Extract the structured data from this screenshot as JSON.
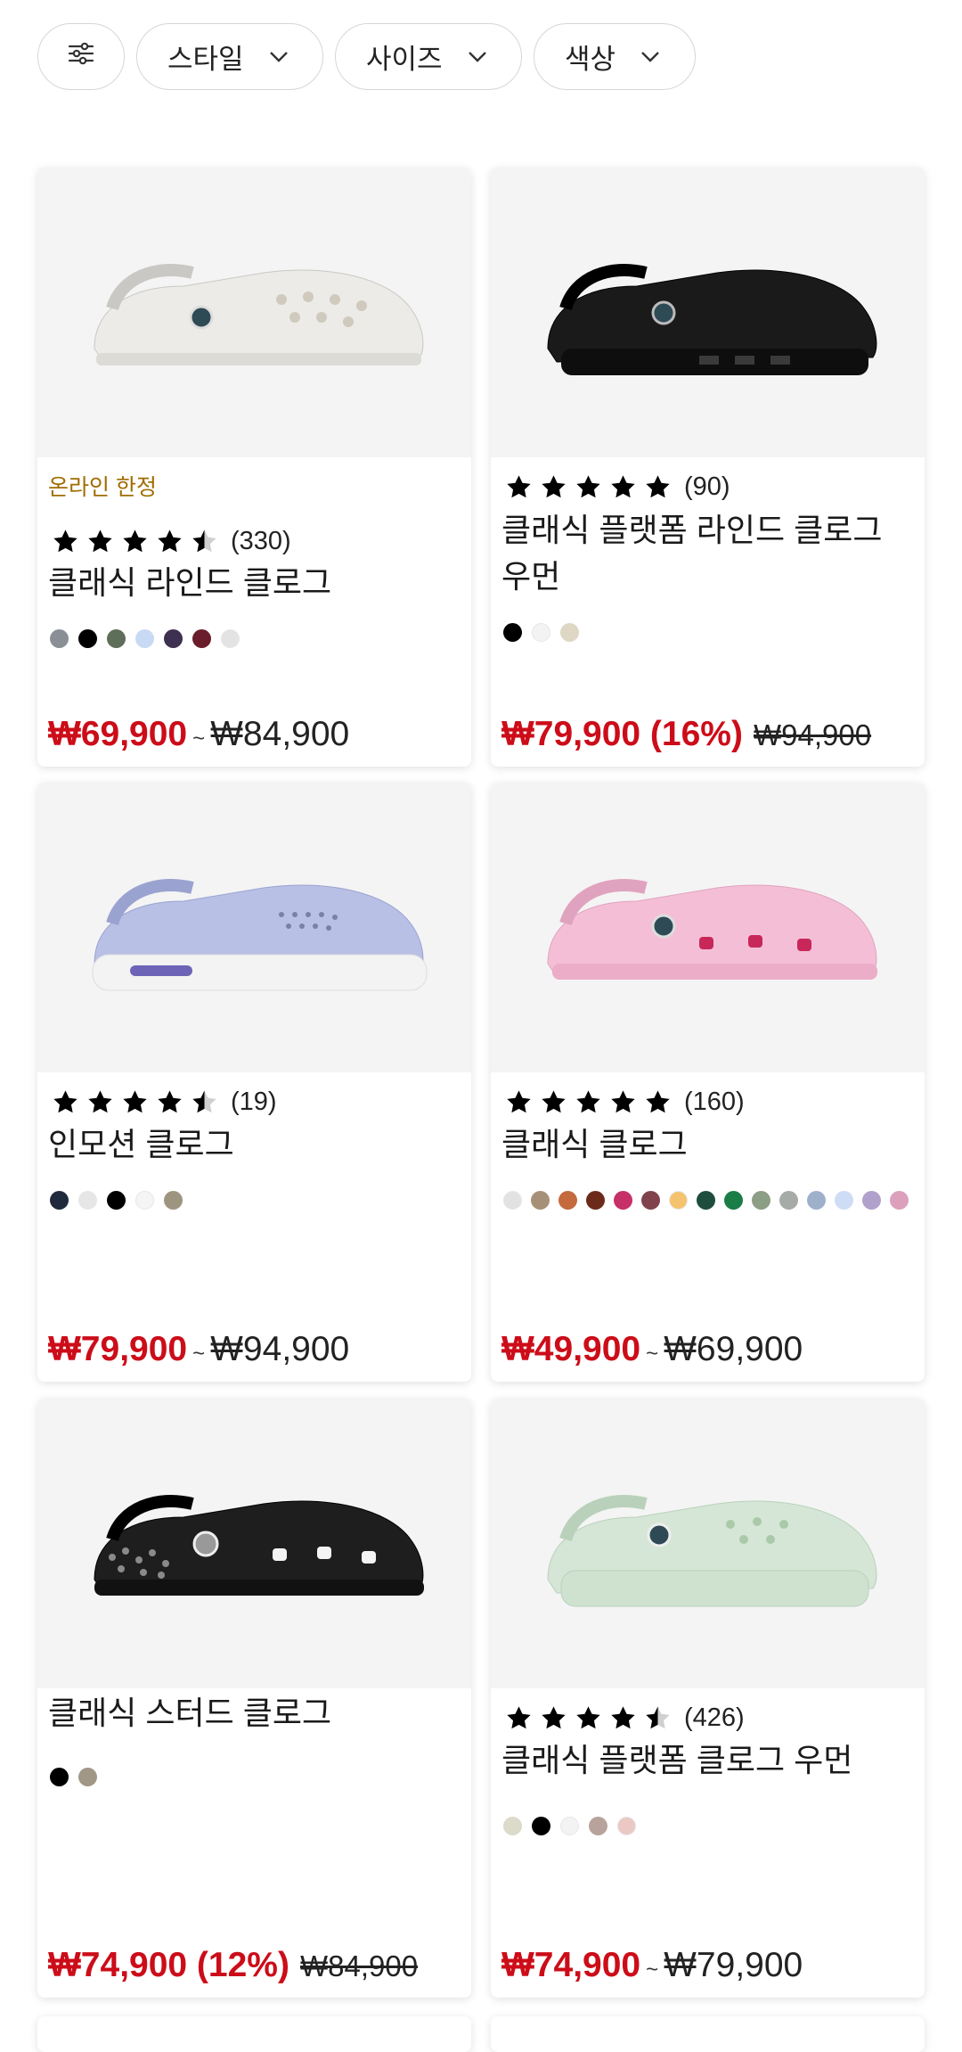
{
  "filters": {
    "icon": "sliders-icon",
    "style_label": "스타일",
    "size_label": "사이즈",
    "color_label": "색상"
  },
  "products": [
    {
      "badge": "온라인 한정",
      "rating": 4.5,
      "review_count": "(330)",
      "name": "클래식 라인드 클로그",
      "swatches": [
        "#8a8f96",
        "#000000",
        "#5f6e58",
        "#c8daf3",
        "#3e3050",
        "#6a1d2a",
        "#e3e3e3"
      ],
      "price_sale": "₩69,900",
      "price_separator": "~",
      "price_regular": "₩84,900",
      "price_original": ""
    },
    {
      "badge": "",
      "rating": 5,
      "review_count": "(90)",
      "name": "클래식 플랫폼 라인드 클로그 우먼",
      "swatches": [
        "#000000",
        "#f3f3f3",
        "#ddd7c4"
      ],
      "price_sale": "₩79,900 (16%)",
      "price_separator": "",
      "price_regular": "",
      "price_original": "₩94,900"
    },
    {
      "badge": "",
      "rating": 4.5,
      "review_count": "(19)",
      "name": "인모션 클로그",
      "swatches": [
        "#1f2a3c",
        "#e6e6e6",
        "#000000",
        "#f5f5f5",
        "#9e9580"
      ],
      "price_sale": "₩79,900",
      "price_separator": "~",
      "price_regular": "₩94,900",
      "price_original": ""
    },
    {
      "badge": "",
      "rating": 5,
      "review_count": "(160)",
      "name": "클래식 클로그",
      "swatches": [
        "#e2e2e2",
        "#a69178",
        "#c46a3d",
        "#6c2a1a",
        "#c62f68",
        "#80434d",
        "#f5c36e",
        "#1e4d3d",
        "#1a7d45",
        "#8c9e86",
        "#a7aba8",
        "#9fb0cc",
        "#cfdcf5",
        "#b2a0cc",
        "#dca0bc"
      ],
      "price_sale": "₩49,900",
      "price_separator": "~",
      "price_regular": "₩69,900",
      "price_original": ""
    },
    {
      "badge": "",
      "rating": null,
      "review_count": "",
      "name": "클래식 스터드 클로그",
      "swatches": [
        "#000000",
        "#a09786"
      ],
      "price_sale": "₩74,900 (12%)",
      "price_separator": "",
      "price_regular": "",
      "price_original": "₩84,900"
    },
    {
      "badge": "",
      "rating": 4.5,
      "review_count": "(426)",
      "name": "클래식 플랫폼 클로그 우먼",
      "swatches": [
        "#dcdac8",
        "#000000",
        "#f3f3f3",
        "#b8a39c",
        "#ebc8c4"
      ],
      "price_sale": "₩74,900",
      "price_separator": "~",
      "price_regular": "₩79,900",
      "price_original": ""
    }
  ],
  "colors": {
    "sale_price": "#cc0d19",
    "badge": "#a06d00",
    "star": "#000000"
  }
}
